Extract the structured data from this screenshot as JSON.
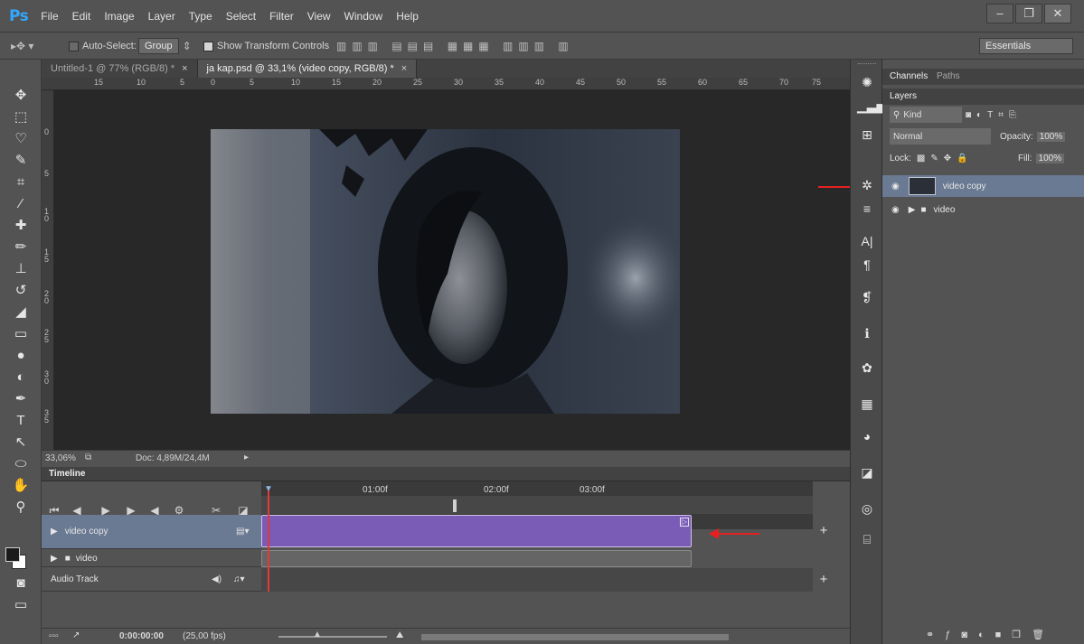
{
  "app": {
    "logo": "Ps"
  },
  "menu": [
    "File",
    "Edit",
    "Image",
    "Layer",
    "Type",
    "Select",
    "Filter",
    "View",
    "Window",
    "Help"
  ],
  "window_controls": {
    "minimize": "–",
    "restore": "❐",
    "close": "✕"
  },
  "options_bar": {
    "auto_select_label": "Auto-Select:",
    "auto_select_value": "Group",
    "show_transform_label": "Show Transform Controls",
    "workspace": "Essentials"
  },
  "doc_tabs": [
    {
      "label": "Untitled-1 @ 77% (RGB/8) *",
      "close": "×"
    },
    {
      "label": "ja kap.psd @ 33,1% (video copy, RGB/8) *",
      "close": "×"
    }
  ],
  "ruler_top_ticks": [
    "15",
    "10",
    "5",
    "0",
    "5",
    "10",
    "15",
    "20",
    "25",
    "30",
    "35",
    "40",
    "45",
    "50",
    "55",
    "60",
    "65",
    "70",
    "75"
  ],
  "ruler_left_ticks": [
    "0",
    "5",
    "1\n0",
    "1\n5",
    "2\n0",
    "2\n5",
    "3\n0",
    "3\n5"
  ],
  "status": {
    "zoom": "33,06%",
    "doc": "Doc: 4,89M/24,4M"
  },
  "timeline": {
    "tab": "Timeline",
    "times": [
      "01:00f",
      "02:00f",
      "03:00f"
    ],
    "tracks": [
      {
        "name": "video copy"
      },
      {
        "name": "video"
      },
      {
        "name": "Audio Track"
      }
    ],
    "footer_time": "0:00:00:00",
    "footer_fps": "(25,00 fps)"
  },
  "panels": {
    "channels_tab": "Channels",
    "paths_tab": "Paths",
    "layers_tab": "Layers",
    "kind_label": "Kind",
    "blend_mode": "Normal",
    "opacity_label": "Opacity:",
    "opacity_value": "100%",
    "lock_label": "Lock:",
    "fill_label": "Fill:",
    "fill_value": "100%",
    "layers": [
      {
        "name": "video copy",
        "selected": true
      },
      {
        "name": "video",
        "selected": false
      }
    ]
  },
  "colors": {
    "clip_purple": "#7a5bb5",
    "accent_red": "#e62020",
    "ps_blue": "#31a8ff"
  }
}
